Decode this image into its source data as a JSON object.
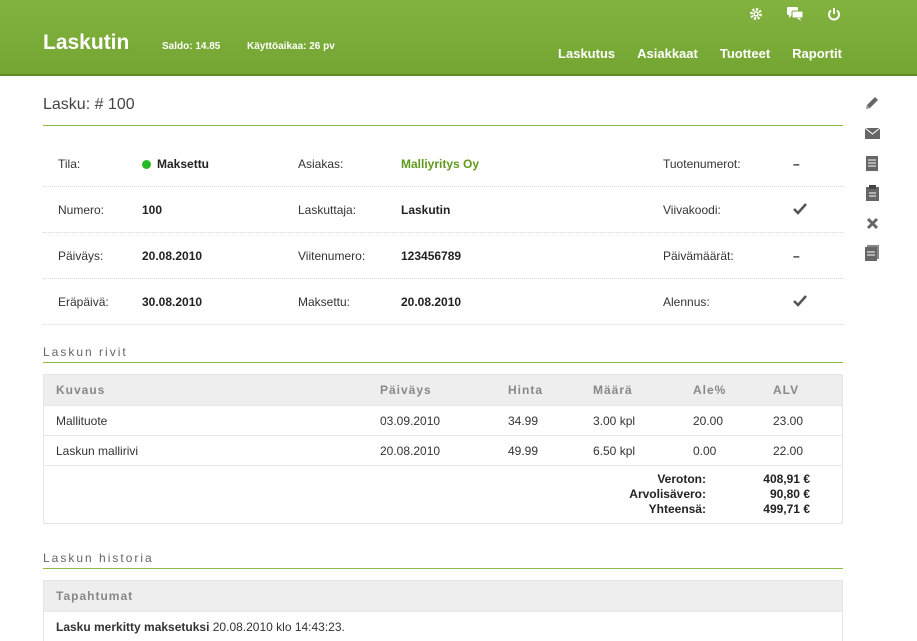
{
  "header": {
    "brand": "Laskutin",
    "saldo": "Saldo: 14.85",
    "kayttoaika": "Käyttöaikaa: 26 pv",
    "nav": [
      "Laskutus",
      "Asiakkaat",
      "Tuotteet",
      "Raportit"
    ],
    "icons": [
      "gear-icon",
      "chat-icon",
      "power-icon"
    ]
  },
  "page": {
    "title": "Lasku: # 100"
  },
  "side_tools": [
    "pencil-icon",
    "envelope-icon",
    "document-icon",
    "clipboard-icon",
    "close-icon",
    "copy-icon"
  ],
  "info": {
    "tila_label": "Tila:",
    "tila_value": "Maksettu",
    "asiakas_label": "Asiakas:",
    "asiakas_value": "Malliyritys Oy",
    "tuotenumerot_label": "Tuotenumerot:",
    "tuotenumerot_value": "–",
    "numero_label": "Numero:",
    "numero_value": "100",
    "laskuttaja_label": "Laskuttaja:",
    "laskuttaja_value": "Laskutin",
    "viivakoodi_label": "Viivakoodi:",
    "paivays_label": "Päiväys:",
    "paivays_value": "20.08.2010",
    "viitenumero_label": "Viitenumero:",
    "viitenumero_value": "123456789",
    "paivamaarat_label": "Päivämäärät:",
    "paivamaarat_value": "–",
    "erapaiva_label": "Eräpäivä:",
    "erapaiva_value": "30.08.2010",
    "maksettu_label": "Maksettu:",
    "maksettu_value": "20.08.2010",
    "alennus_label": "Alennus:",
    "status_color": "#25b825"
  },
  "rows_section": {
    "title": "Laskun rivit",
    "columns": [
      "Kuvaus",
      "Päiväys",
      "Hinta",
      "Määrä",
      "Ale%",
      "ALV"
    ],
    "rows": [
      [
        "Mallituote",
        "03.09.2010",
        "34.99",
        "3.00 kpl",
        "20.00",
        "23.00"
      ],
      [
        "Laskun mallirivi",
        "20.08.2010",
        "49.99",
        "6.50 kpl",
        "0.00",
        "22.00"
      ]
    ],
    "totals": {
      "veroton_label": "Veroton:",
      "veroton_value": "408,91 €",
      "alv_label": "Arvolisävero:",
      "alv_value": "90,80 €",
      "yhteensa_label": "Yhteensä:",
      "yhteensa_value": "499,71 €"
    }
  },
  "history_section": {
    "title": "Laskun historia",
    "header": "Tapahtumat",
    "event_bold": "Lasku merkitty maksetuksi",
    "event_rest": " 20.08.2010 klo 14:43:23."
  }
}
